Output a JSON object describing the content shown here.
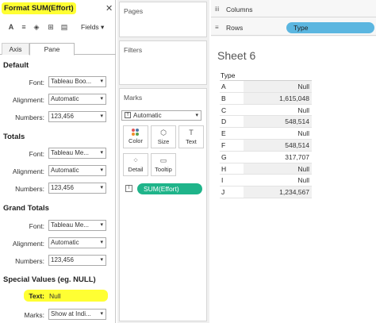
{
  "format_pane": {
    "title": "Format SUM(Effort)",
    "fields_label": "Fields",
    "tabs": [
      "Axis",
      "Pane"
    ],
    "sections": {
      "default": {
        "heading": "Default",
        "font_label": "Font:",
        "font_value": "Tableau Boo...",
        "alignment_label": "Alignment:",
        "alignment_value": "Automatic",
        "numbers_label": "Numbers:",
        "numbers_value": "123,456"
      },
      "totals": {
        "heading": "Totals",
        "font_label": "Font:",
        "font_value": "Tableau Me...",
        "alignment_label": "Alignment:",
        "alignment_value": "Automatic",
        "numbers_label": "Numbers:",
        "numbers_value": "123,456"
      },
      "grand_totals": {
        "heading": "Grand Totals",
        "font_label": "Font:",
        "font_value": "Tableau Me...",
        "alignment_label": "Alignment:",
        "alignment_value": "Automatic",
        "numbers_label": "Numbers:",
        "numbers_value": "123,456"
      },
      "special": {
        "heading": "Special Values (eg. NULL)",
        "text_label": "Text:",
        "text_value": "Null",
        "marks_label": "Marks:",
        "marks_value": "Show at Indi..."
      }
    }
  },
  "cards": {
    "pages": "Pages",
    "filters": "Filters",
    "marks": {
      "title": "Marks",
      "type": "Automatic",
      "buttons": [
        "Color",
        "Size",
        "Text",
        "Detail",
        "Tooltip"
      ],
      "pill": "SUM(Effort)"
    }
  },
  "shelves": {
    "columns": "Columns",
    "rows": "Rows",
    "rows_pill": "Type"
  },
  "sheet": {
    "title": "Sheet 6",
    "column_header": "Type",
    "rows": [
      {
        "k": "A",
        "v": "Null"
      },
      {
        "k": "B",
        "v": "1,615,048"
      },
      {
        "k": "C",
        "v": "Null"
      },
      {
        "k": "D",
        "v": "548,514"
      },
      {
        "k": "E",
        "v": "Null"
      },
      {
        "k": "F",
        "v": "548,514"
      },
      {
        "k": "G",
        "v": "317,707"
      },
      {
        "k": "H",
        "v": "Null"
      },
      {
        "k": "I",
        "v": "Null"
      },
      {
        "k": "J",
        "v": "1,234,567"
      }
    ]
  },
  "colors": {
    "highlight": "#ffff33",
    "measure_pill": "#1fb48a",
    "dimension_pill": "#5bb6e0"
  }
}
